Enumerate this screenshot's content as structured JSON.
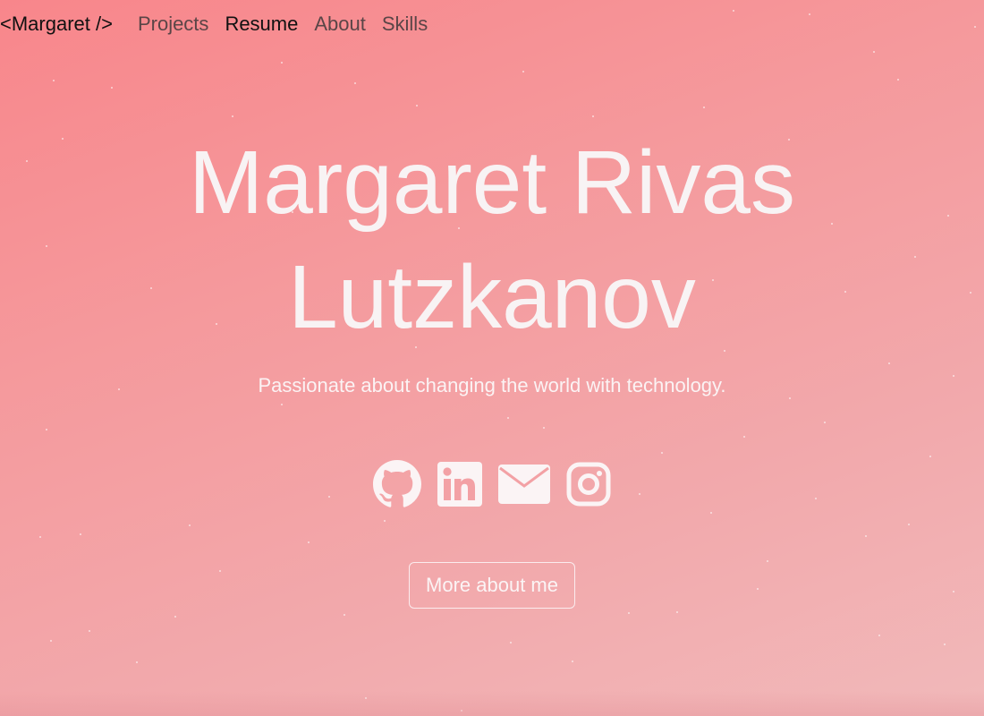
{
  "nav": {
    "brand": "<Margaret />",
    "links": [
      {
        "label": "Projects"
      },
      {
        "label": "Resume"
      },
      {
        "label": "About"
      },
      {
        "label": "Skills"
      }
    ]
  },
  "hero": {
    "name_line1": "Margaret Rivas",
    "name_line2": "Lutzkanov",
    "tagline": "Passionate about changing the world with technology.",
    "cta_label": "More about me"
  },
  "socials": [
    {
      "icon": "github-icon"
    },
    {
      "icon": "linkedin-icon"
    },
    {
      "icon": "email-icon"
    },
    {
      "icon": "instagram-icon"
    }
  ],
  "colors": {
    "gradient_start": "#f8868b",
    "gradient_end": "#f1b9ba",
    "text_light": "#f8f3f4",
    "nav_text": "#5a4547",
    "nav_active": "#111111"
  }
}
